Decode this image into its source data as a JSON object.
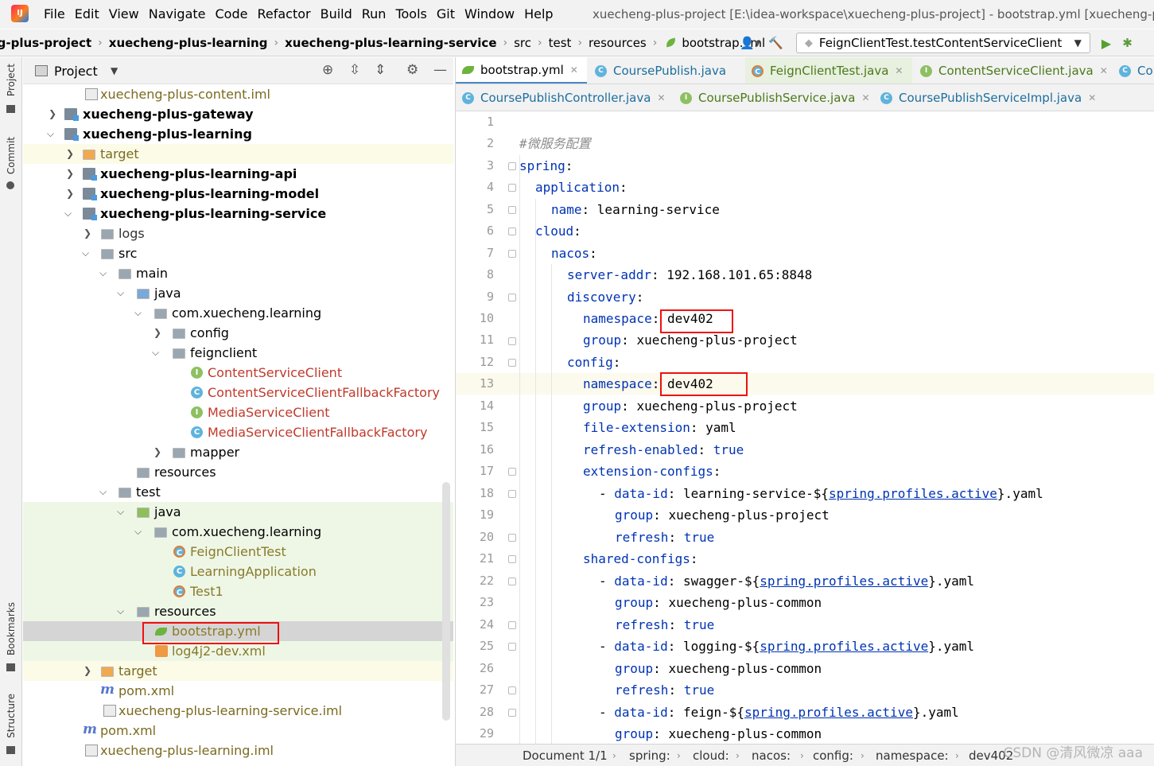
{
  "app": {
    "logo": "IJ"
  },
  "menu": [
    "File",
    "Edit",
    "View",
    "Navigate",
    "Code",
    "Refactor",
    "Build",
    "Run",
    "Tools",
    "Git",
    "Window",
    "Help"
  ],
  "window_title": "xuecheng-plus-project [E:\\idea-workspace\\xuecheng-plus-project] - bootstrap.yml [xuecheng-pl",
  "breadcrumbs": [
    "ng-plus-project",
    "xuecheng-plus-learning",
    "xuecheng-plus-learning-service",
    "src",
    "test",
    "resources",
    "bootstrap.yml"
  ],
  "run_config": {
    "value": "FeignClientTest.testContentServiceClient"
  },
  "project_panel": {
    "title": "Project"
  },
  "left_strip": [
    "Project",
    "Commit",
    "Bookmarks",
    "Structure"
  ],
  "tree": [
    {
      "label": "xuecheng-plus-content.iml"
    },
    {
      "label": "xuecheng-plus-gateway"
    },
    {
      "label": "xuecheng-plus-learning"
    },
    {
      "label": "target"
    },
    {
      "label": "xuecheng-plus-learning-api"
    },
    {
      "label": "xuecheng-plus-learning-model"
    },
    {
      "label": "xuecheng-plus-learning-service"
    },
    {
      "label": "logs"
    },
    {
      "label": "src"
    },
    {
      "label": "main"
    },
    {
      "label": "java"
    },
    {
      "label": "com.xuecheng.learning"
    },
    {
      "label": "config"
    },
    {
      "label": "feignclient"
    },
    {
      "label": "ContentServiceClient"
    },
    {
      "label": "ContentServiceClientFallbackFactory"
    },
    {
      "label": "MediaServiceClient"
    },
    {
      "label": "MediaServiceClientFallbackFactory"
    },
    {
      "label": "mapper"
    },
    {
      "label": "resources"
    },
    {
      "label": "test"
    },
    {
      "label": "java"
    },
    {
      "label": "com.xuecheng.learning"
    },
    {
      "label": "FeignClientTest"
    },
    {
      "label": "LearningApplication"
    },
    {
      "label": "Test1"
    },
    {
      "label": "resources"
    },
    {
      "label": "bootstrap.yml"
    },
    {
      "label": "log4j2-dev.xml"
    },
    {
      "label": "target"
    },
    {
      "label": "pom.xml"
    },
    {
      "label": "xuecheng-plus-learning-service.iml"
    },
    {
      "label": "pom.xml"
    },
    {
      "label": "xuecheng-plus-learning.iml"
    }
  ],
  "tabs_row1": [
    "bootstrap.yml",
    "CoursePublish.java",
    "FeignClientTest.java",
    "ContentServiceClient.java",
    "Con"
  ],
  "tabs_row2": [
    "CoursePublishController.java",
    "CoursePublishService.java",
    "CoursePublishServiceImpl.java"
  ],
  "line_numbers": [
    "1",
    "2",
    "3",
    "4",
    "5",
    "6",
    "7",
    "8",
    "9",
    "10",
    "11",
    "12",
    "13",
    "14",
    "15",
    "16",
    "17",
    "18",
    "19",
    "20",
    "21",
    "22",
    "23",
    "24",
    "25",
    "26",
    "27",
    "28",
    "29"
  ],
  "code": {
    "l2": "#微服务配置",
    "l3": "spring",
    "l4": "application",
    "l5k": "name",
    "l5v": "learning-service",
    "l6": "cloud",
    "l7": "nacos",
    "l8k": "server-addr",
    "l8v": "192.168.101.65:8848",
    "l9": "discovery",
    "l10k": "namespace",
    "l10v": "dev402",
    "l11k": "group",
    "l11v": "xuecheng-plus-project",
    "l12": "config",
    "l13k": "namespace",
    "l13v": "dev402",
    "l14k": "group",
    "l14v": "xuecheng-plus-project",
    "l15k": "file-extension",
    "l15v": "yaml",
    "l16k": "refresh-enabled",
    "l16v": "true",
    "l17": "extension-configs",
    "l18k": "data-id",
    "l18a": "learning-service-${",
    "l18b": "spring.profiles.active",
    "l18c": "}.yaml",
    "l19k": "group",
    "l19v": "xuecheng-plus-project",
    "l20k": "refresh",
    "l20v": "true",
    "l21": "shared-configs",
    "l22k": "data-id",
    "l22a": "swagger-${",
    "l22b": "spring.profiles.active",
    "l22c": "}.yaml",
    "l23k": "group",
    "l23v": "xuecheng-plus-common",
    "l24k": "refresh",
    "l24v": "true",
    "l25k": "data-id",
    "l25a": "logging-${",
    "l25b": "spring.profiles.active",
    "l25c": "}.yaml",
    "l26k": "group",
    "l26v": "xuecheng-plus-common",
    "l27k": "refresh",
    "l27v": "true",
    "l28k": "data-id",
    "l28a": "feign-${",
    "l28b": "spring.profiles.active",
    "l28c": "}.yaml",
    "l29k": "group",
    "l29v": "xuecheng-plus-common"
  },
  "status": [
    "Document 1/1",
    "spring:",
    "cloud:",
    "nacos:",
    "config:",
    "namespace:",
    "dev402"
  ],
  "watermark": "CSDN @清风微凉 aaa",
  "colors": {
    "keyword": "#0033b3",
    "highlight_box": "#ee1111",
    "selection": "#d5d5d5"
  }
}
